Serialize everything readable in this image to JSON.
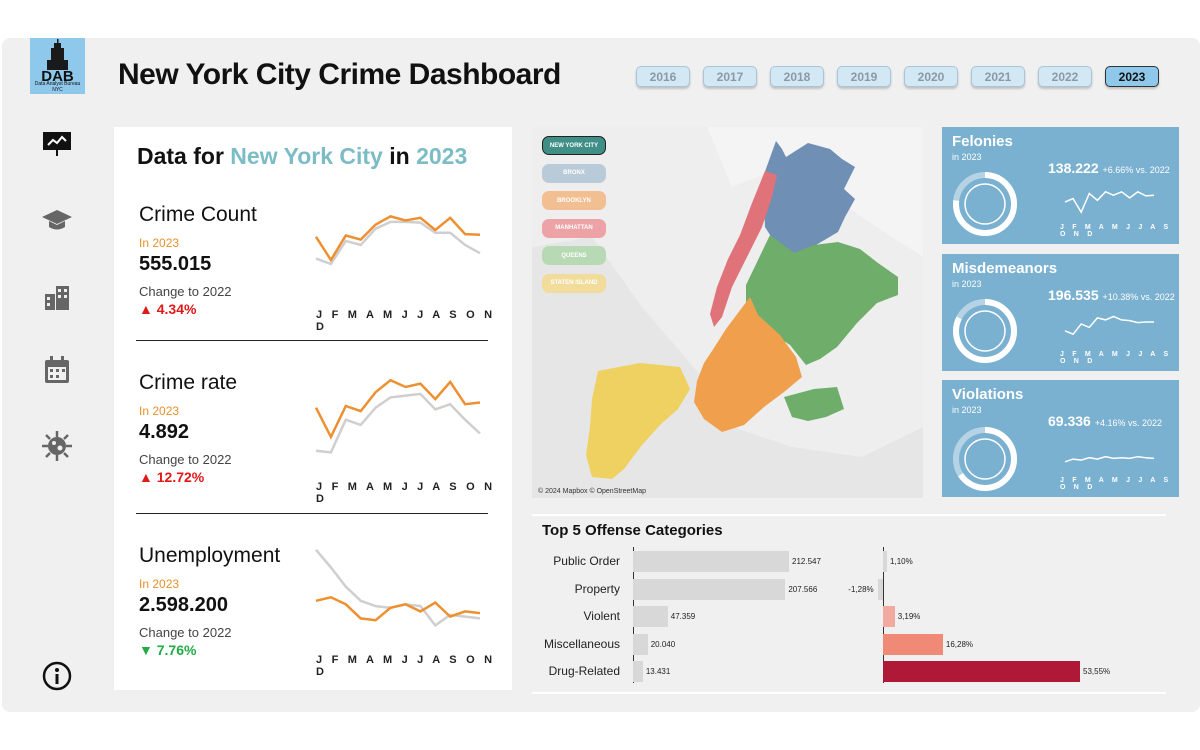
{
  "logo": {
    "text": "DAB",
    "subtext": "Data Analyst Bureau NYC"
  },
  "title": "New York City Crime Dashboard",
  "years": [
    "2016",
    "2017",
    "2018",
    "2019",
    "2020",
    "2021",
    "2022",
    "2023"
  ],
  "selected_year": "2023",
  "sidebar": {
    "icons": [
      "presentation-chart-icon",
      "graduation-cap-icon",
      "buildings-icon",
      "calendar-icon",
      "virus-icon",
      "info-icon"
    ]
  },
  "panel": {
    "prefix": "Data for ",
    "area": "New York City",
    "mid": " in ",
    "year": "2023"
  },
  "months_label": "J F M A M J J A S O N D",
  "metrics": [
    {
      "name": "Crime Count",
      "in_label": "In 2023",
      "value": "555.015",
      "change_label": "Change to 2022",
      "change": "▲ 4.34%",
      "direction": "up",
      "series_2023": [
        0.62,
        0.28,
        0.64,
        0.58,
        0.8,
        0.92,
        0.86,
        0.9,
        0.72,
        0.9,
        0.66,
        0.65
      ],
      "series_2022": [
        0.3,
        0.22,
        0.56,
        0.5,
        0.74,
        0.84,
        0.84,
        0.83,
        0.68,
        0.68,
        0.5,
        0.38
      ]
    },
    {
      "name": "Crime rate",
      "in_label": "In 2023",
      "value": "4.892",
      "change_label": "Change to 2022",
      "change": "▲ 12.72%",
      "direction": "up",
      "series_2023": [
        0.62,
        0.28,
        0.64,
        0.58,
        0.8,
        0.94,
        0.86,
        0.9,
        0.72,
        0.92,
        0.66,
        0.68
      ],
      "series_2022": [
        0.12,
        0.1,
        0.48,
        0.42,
        0.62,
        0.74,
        0.76,
        0.78,
        0.6,
        0.66,
        0.48,
        0.32
      ]
    },
    {
      "name": "Unemployment",
      "in_label": "In 2023",
      "value": "2.598.200",
      "change_label": "Change to 2022",
      "change": "▼ 7.76%",
      "direction": "down",
      "series_2023": [
        0.4,
        0.44,
        0.36,
        0.2,
        0.18,
        0.32,
        0.36,
        0.28,
        0.38,
        0.22,
        0.28,
        0.26
      ],
      "series_2022": [
        0.98,
        0.78,
        0.56,
        0.4,
        0.34,
        0.32,
        0.36,
        0.34,
        0.12,
        0.24,
        0.22,
        0.2
      ]
    }
  ],
  "map": {
    "legend": [
      {
        "label": "NEW YORK CITY",
        "color": "#3f8f86"
      },
      {
        "label": "BRONX",
        "color": "#b9cad8"
      },
      {
        "label": "BROOKLYN",
        "color": "#f2bf92"
      },
      {
        "label": "MANHATTAN",
        "color": "#eda3a5"
      },
      {
        "label": "QUEENS",
        "color": "#b7d9b3"
      },
      {
        "label": "STATEN ISLAND",
        "color": "#f1dc9c"
      }
    ],
    "attribution": "© 2024 Mapbox © OpenStreetMap"
  },
  "kpis": [
    {
      "name": "Felonies",
      "in_label": "in 2023",
      "value": "138.222",
      "change": "+6.66% vs. 2022",
      "spark": [
        0.5,
        0.6,
        0.2,
        0.75,
        0.55,
        0.8,
        0.7,
        0.8,
        0.62,
        0.8,
        0.68,
        0.7
      ]
    },
    {
      "name": "Misdemeanors",
      "in_label": "in 2023",
      "value": "196.535",
      "change": "+10.38% vs. 2022",
      "spark": [
        0.3,
        0.2,
        0.5,
        0.4,
        0.68,
        0.62,
        0.72,
        0.62,
        0.6,
        0.54,
        0.56,
        0.56
      ]
    },
    {
      "name": "Violations",
      "in_label": "in 2023",
      "value": "69.336",
      "change": "+4.16% vs. 2022",
      "spark": [
        0.3,
        0.38,
        0.35,
        0.42,
        0.38,
        0.45,
        0.4,
        0.42,
        0.4,
        0.45,
        0.42,
        0.4
      ]
    }
  ],
  "offense": {
    "title": "Top 5 Offense Categories",
    "categories": [
      "Public Order",
      "Property",
      "Violent",
      "Miscellaneous",
      "Drug-Related"
    ],
    "counts": [
      212547,
      207566,
      47359,
      20040,
      13431
    ],
    "count_labels": [
      "212.547",
      "207.566",
      "47.359",
      "20.040",
      "13.431"
    ],
    "pct": [
      1.1,
      -1.28,
      3.19,
      16.28,
      53.55
    ],
    "pct_labels": [
      "1,10%",
      "-1,28%",
      "3,19%",
      "16,28%",
      "53,55%"
    ],
    "pct_colors": [
      "#d8d8d8",
      "#d8d8d8",
      "#f2aaa0",
      "#f08a76",
      "#b01838"
    ]
  }
}
